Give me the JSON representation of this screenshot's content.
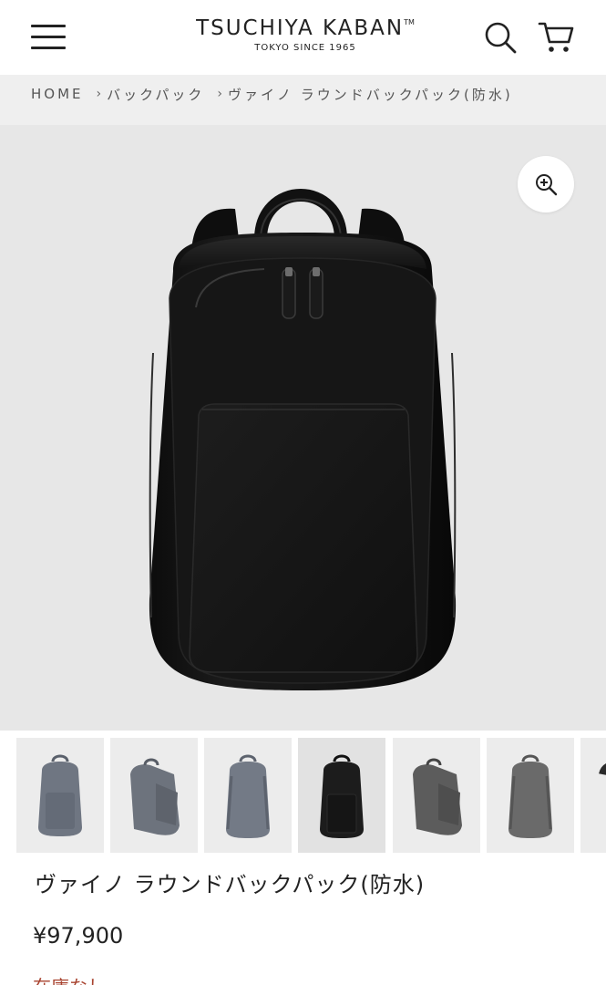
{
  "header": {
    "brand": "TSUCHIYA KABAN",
    "trademark": "TM",
    "tagline": "TOKYO  SINCE 1965",
    "icons": [
      "menu-icon",
      "search-icon",
      "cart-icon"
    ]
  },
  "breadcrumb": {
    "items": [
      "HOME",
      "バックパック",
      "ヴァイノ ラウンドバックパック(防水)"
    ],
    "separator": "›"
  },
  "gallery": {
    "zoom_icon": "zoom-in-icon",
    "background": "#e7e7e7",
    "active_thumb_index": 3,
    "thumb_colors": [
      "#6f7682",
      "#6d737d",
      "#737a86",
      "#1c1c1c",
      "#5c5c5c",
      "#6a6a6a",
      "#2a2a2a"
    ]
  },
  "product": {
    "title": "ヴァイノ ラウンドバックパック(防水)",
    "price": "¥97,900",
    "stock": "在庫なし",
    "stock_color": "#a8432f"
  }
}
